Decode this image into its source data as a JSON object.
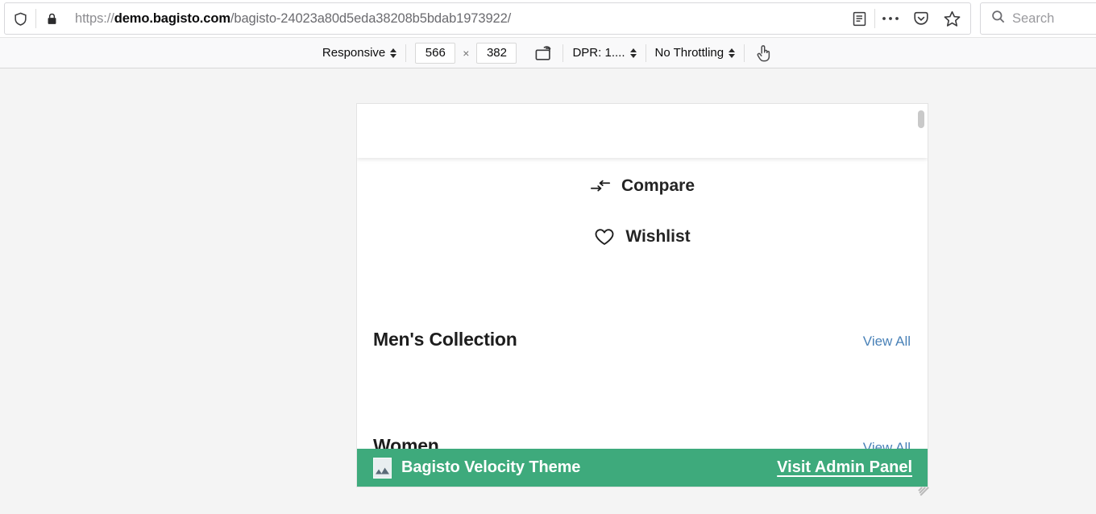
{
  "browser": {
    "url": {
      "scheme": "https://",
      "host_pre": "demo.",
      "host_strong": "bagisto.com",
      "path": "/bagisto-24023a80d5eda38208b5bdab1973922/",
      "full": "https://demo.bagisto.com/bagisto-24023a80d5eda38208b5bdab1973922/"
    },
    "icons": {
      "tracking_protection": "shield-icon",
      "site_security": "lock-icon",
      "reader_view": "reader-view-icon",
      "page_actions": "ellipsis-icon",
      "pocket": "pocket-icon",
      "bookmark": "star-icon",
      "search": "search-icon"
    },
    "search": {
      "placeholder": "Search",
      "value": ""
    }
  },
  "rdm_toolbar": {
    "device_select": "Responsive",
    "width": "566",
    "height": "382",
    "size_separator": "×",
    "rotate_icon": "rotate-viewport-icon",
    "dpr_select": "DPR: 1....",
    "throttling_select": "No Throttling",
    "touch_icon": "touch-simulation-icon"
  },
  "page": {
    "utility_links": [
      {
        "label": "Compare",
        "icon": "compare-arrows-icon"
      },
      {
        "label": "Wishlist",
        "icon": "heart-icon"
      }
    ],
    "collections": [
      {
        "title": "Men's Collection",
        "view_all": "View All"
      },
      {
        "title": "Women",
        "view_all": "View All"
      }
    ]
  },
  "theme_banner": {
    "icon": "broken-image-icon",
    "title": "Bagisto Velocity Theme",
    "admin_link": "Visit Admin Panel",
    "color": "#3eaa7c"
  },
  "colors": {
    "banner_green": "#3eaa7c",
    "link_blue": "#4a82b8",
    "stage_background": "#f4f4f4",
    "toolbar_background": "#f9f9fa"
  }
}
